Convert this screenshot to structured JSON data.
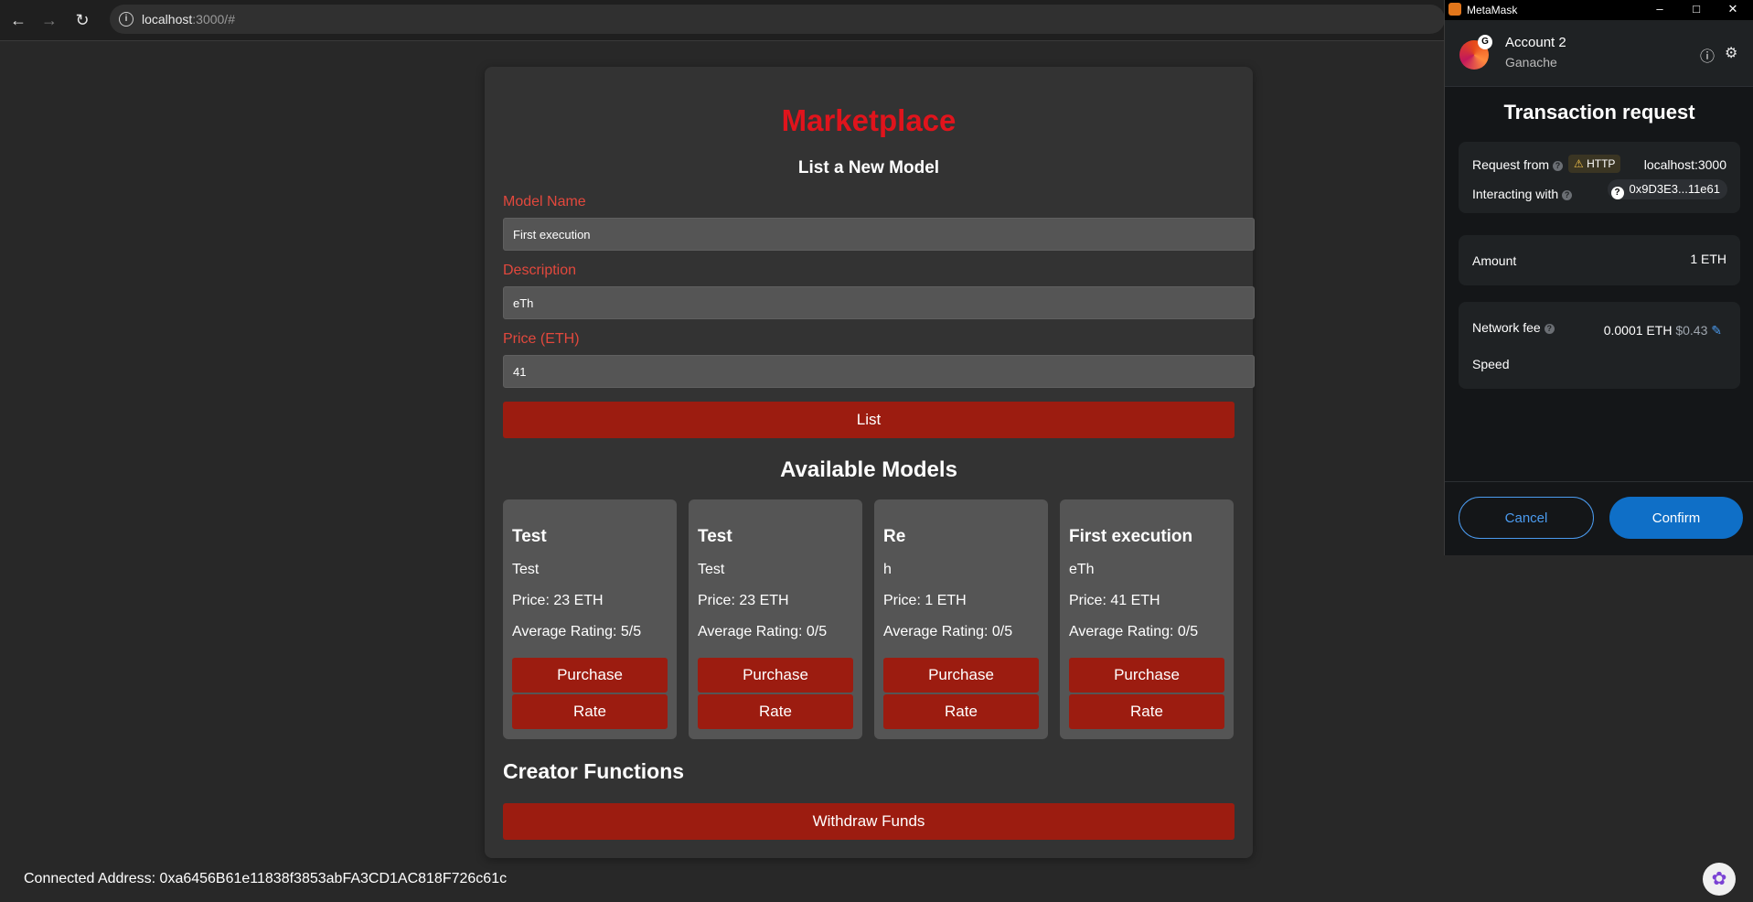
{
  "browser": {
    "url_host": "localhost",
    "url_path": ":3000/#"
  },
  "page": {
    "title": "Marketplace",
    "list_heading": "List a New Model",
    "fields": {
      "model_name": {
        "label": "Model Name",
        "value": "First execution"
      },
      "description": {
        "label": "Description",
        "value": "eTh"
      },
      "price": {
        "label": "Price (ETH)",
        "value": "41"
      }
    },
    "list_button": "List",
    "available_heading": "Available Models",
    "models": [
      {
        "name": "Test",
        "description": "Test",
        "price": "Price: 23 ETH",
        "rating": "Average Rating: 5/5",
        "purchase": "Purchase",
        "rate": "Rate"
      },
      {
        "name": "Test",
        "description": "Test",
        "price": "Price: 23 ETH",
        "rating": "Average Rating: 0/5",
        "purchase": "Purchase",
        "rate": "Rate"
      },
      {
        "name": "Re",
        "description": "h",
        "price": "Price: 1 ETH",
        "rating": "Average Rating: 0/5",
        "purchase": "Purchase",
        "rate": "Rate"
      },
      {
        "name": "First execution",
        "description": "eTh",
        "price": "Price: 41 ETH",
        "rating": "Average Rating: 0/5",
        "purchase": "Purchase",
        "rate": "Rate"
      }
    ],
    "creator_heading": "Creator Functions",
    "withdraw_button": "Withdraw Funds",
    "connected_address": "Connected Address: 0xa6456B61e11838f3853abFA3CD1AC818F726c61c"
  },
  "metamask": {
    "window_title": "MetaMask",
    "account_name": "Account 2",
    "account_badge": "G",
    "network": "Ganache",
    "heading": "Transaction request",
    "request_from_label": "Request from",
    "http_badge": "HTTP",
    "request_from_value": "localhost:3000",
    "interacting_with_label": "Interacting with",
    "interacting_with_value": "0x9D3E3...11e61",
    "amount_label": "Amount",
    "amount_value": "1 ETH",
    "network_fee_label": "Network fee",
    "network_fee_eth": "0.0001 ETH",
    "network_fee_usd": "$0.43",
    "speed_label": "Speed",
    "cancel_button": "Cancel",
    "confirm_button": "Confirm"
  },
  "colors": {
    "accent_red": "#e0141c",
    "button_red": "#9c1c10",
    "metamask_blue": "#0f6fc7"
  }
}
